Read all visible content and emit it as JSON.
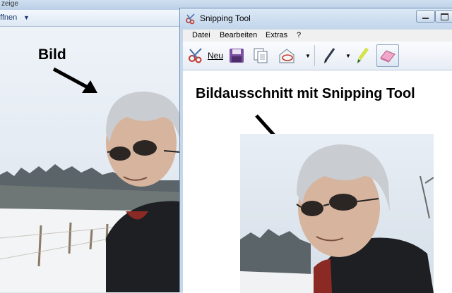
{
  "background_window": {
    "title_fragment": "zeige",
    "open_menu_label": "ffnen",
    "photo_label": "Bild"
  },
  "snipping_tool": {
    "title": "Snipping Tool",
    "menu": [
      "Datei",
      "Bearbeiten",
      "Extras",
      "?"
    ],
    "toolbar": {
      "new_label": "Neu"
    },
    "canvas_heading": "Bildausschnitt mit Snipping Tool"
  }
}
